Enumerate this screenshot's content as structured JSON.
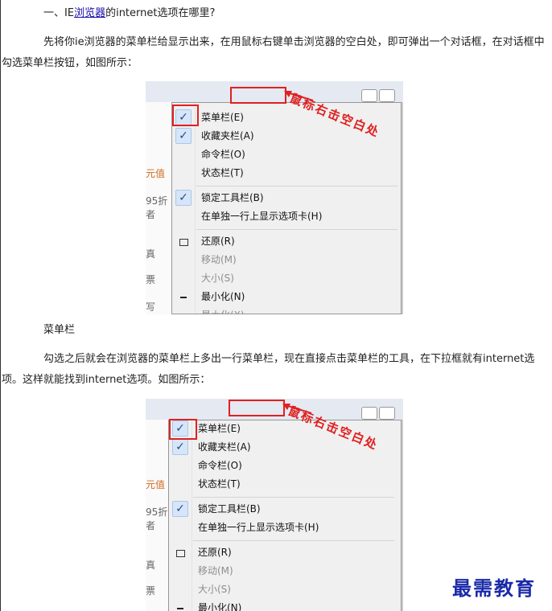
{
  "article": {
    "heading_prefix": "一、IE",
    "heading_link": "浏览器",
    "heading_suffix": "的internet选项在哪里?",
    "para1": "先将你ie浏览器的菜单栏给显示出来，在用鼠标右键单击浏览器的空白处，即可弹出一个对话框，在对话框中勾选菜单栏按钮，如图所示：",
    "caption": "菜单栏",
    "para2": "勾选之后就会在浏览器的菜单栏上多出一行菜单栏，现在直接点击菜单栏的工具，在下拉框就有internet选项。这样就能找到internet选项。如图所示："
  },
  "screenshot": {
    "annotation": "鼠标右击空白处",
    "left_fragments": [
      "元值",
      "95折者",
      "真",
      "票",
      "写"
    ],
    "menu": {
      "menubar": "菜单栏(E)",
      "favorites": "收藏夹栏(A)",
      "command": "命令栏(O)",
      "status": "状态栏(T)",
      "lock": "锁定工具栏(B)",
      "tabs_row": "在单独一行上显示选项卡(H)",
      "restore": "还原(R)",
      "move": "移动(M)",
      "size": "大小(S)",
      "minimize": "最小化(N)",
      "maximize": "最大化(X)"
    },
    "check_glyph": "✓"
  },
  "watermark": "最需教育",
  "colors": {
    "annotation_red": "#e02020",
    "link_blue": "#1a0dab",
    "watermark_blue": "#1a2aa8"
  }
}
